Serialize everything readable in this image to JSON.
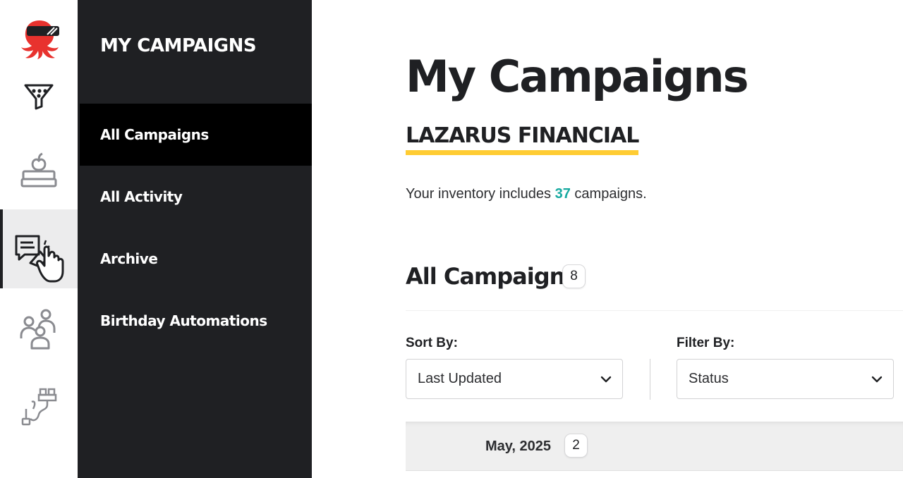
{
  "colors": {
    "accent_teal": "#16a9a0",
    "highlight_yellow": "#ffcc33",
    "logo_red": "#e8322e",
    "dark_nav": "#1f2023"
  },
  "rail": {
    "items": [
      {
        "icon": "funnel-icon"
      },
      {
        "icon": "books-apple-icon"
      },
      {
        "icon": "campaigns-megaphone-icon",
        "active": true
      },
      {
        "icon": "people-icon"
      },
      {
        "icon": "integrations-plug-icon"
      }
    ]
  },
  "subnav": {
    "title": "MY CAMPAIGNS",
    "items": [
      {
        "label": "All Campaigns",
        "active": true
      },
      {
        "label": "All Activity"
      },
      {
        "label": "Archive"
      },
      {
        "label": "Birthday Automations"
      }
    ]
  },
  "main": {
    "title": "My Campaigns",
    "org_name": "LAZARUS FINANCIAL",
    "inventory_prefix": "Your inventory includes ",
    "inventory_count": "37",
    "inventory_suffix": " campaigns.",
    "section_title": "All Campaigns",
    "section_count": "8",
    "sort_label": "Sort By:",
    "sort_value": "Last Updated",
    "filter_label": "Filter By:",
    "filter_value": "Status",
    "groups": [
      {
        "label": "May, 2025",
        "count": "2"
      }
    ]
  }
}
